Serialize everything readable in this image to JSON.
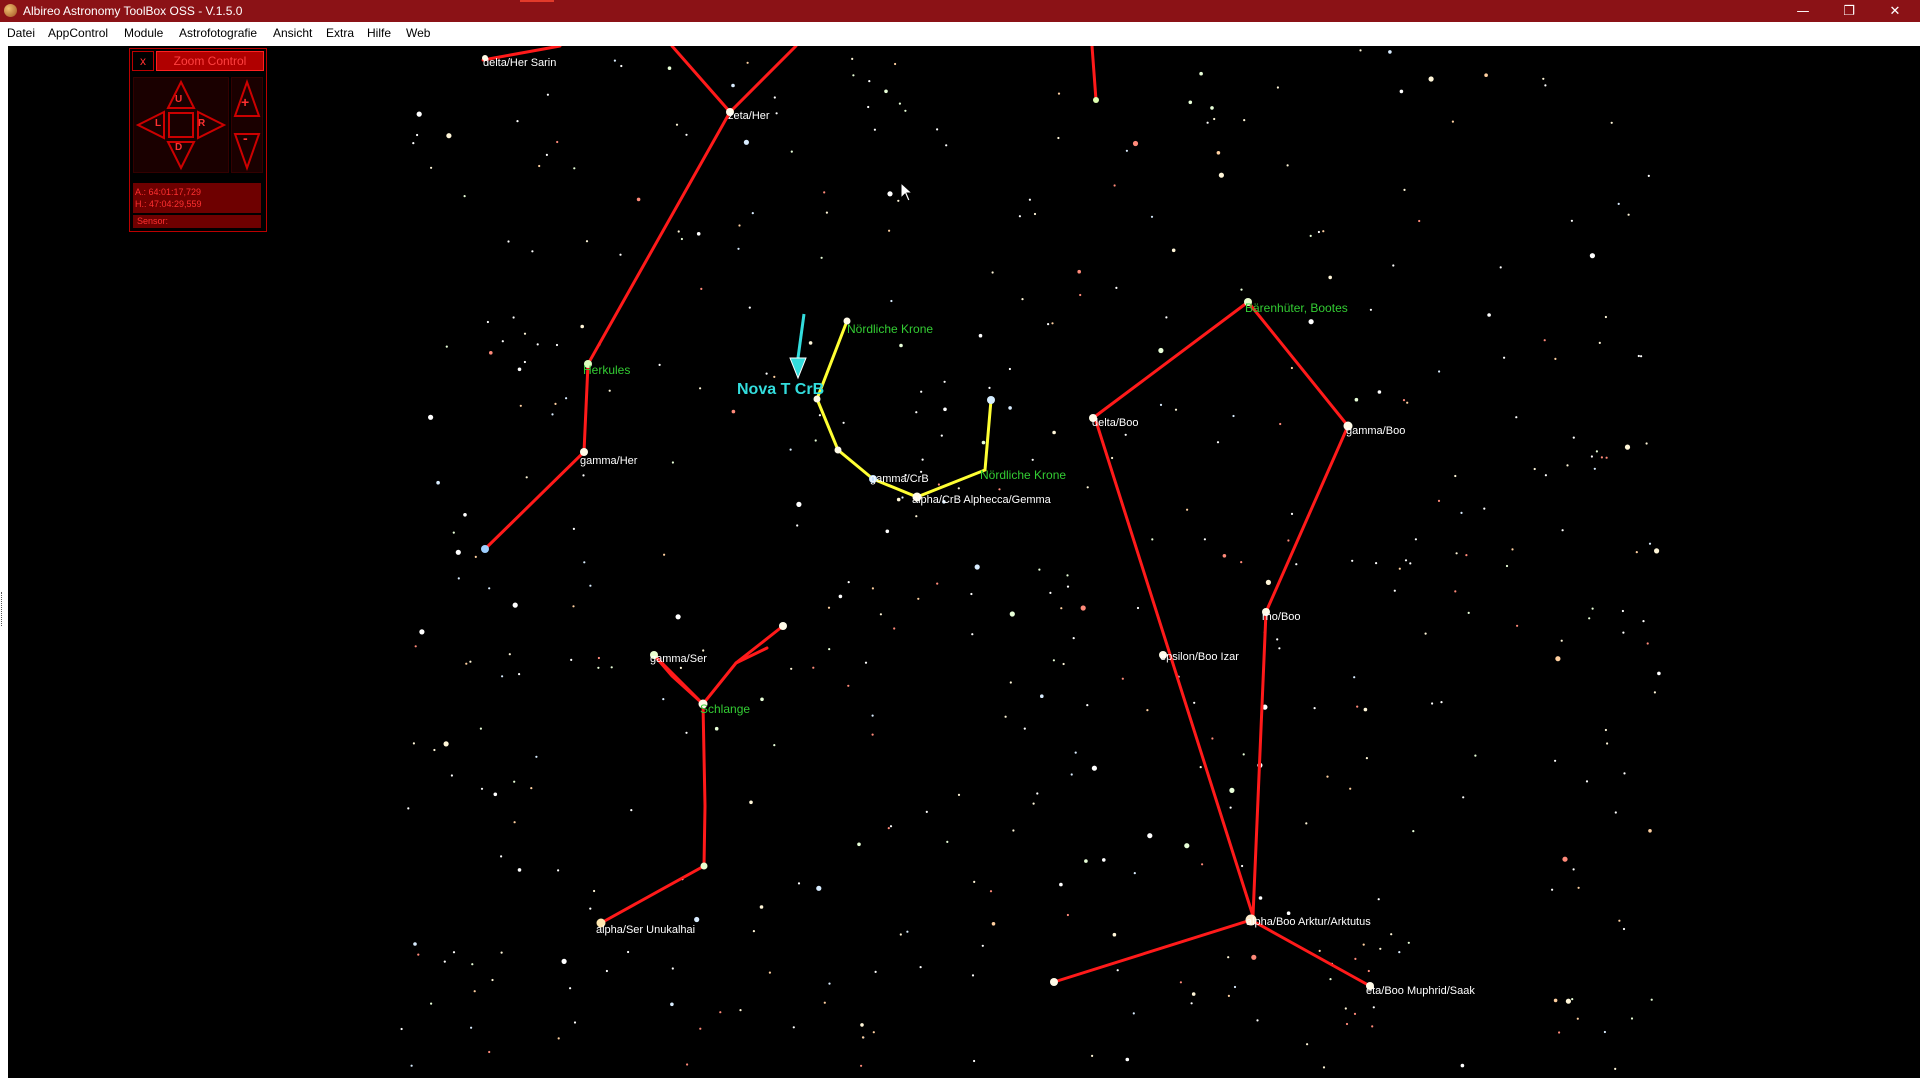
{
  "window": {
    "title": "Albireo Astronomy ToolBox OSS - V.1.5.0",
    "minimize": "—",
    "restore": "❐",
    "close": "✕"
  },
  "menu": [
    "Datei",
    "AppControl",
    "Module",
    "Astrofotografie",
    "Ansicht",
    "Extra",
    "Hilfe",
    "Web"
  ],
  "zoom_control": {
    "close_label": "x",
    "title": "Zoom Control",
    "up": "U",
    "down": "D",
    "left": "L",
    "right": "R",
    "zoom_in": "+",
    "zoom_out": "-",
    "azimuth": "A.: 64:01:17,729",
    "height": "H.: 47:04:29,559",
    "sensor": "Sensor:"
  },
  "colors": {
    "sky": "#000000",
    "constellation_line": "#ff1a1a",
    "highlight_line": "#ffff33",
    "constellation_label": "#33cc33",
    "star_label": "#ffffff",
    "marker": "#33dddd",
    "titlebar": "#8b1216"
  },
  "marker": {
    "label": "Nova T CrB",
    "icon": "arrow-down-icon"
  },
  "constellation_labels": [
    "Nördliche Krone",
    "Nördliche Krone",
    "Herkules",
    "Bärenhüter, Bootes",
    "Schlange"
  ],
  "star_labels": [
    "delta/Her Sarin",
    "zeta/Her",
    "gamma/Her",
    "gamma/CrB",
    "alpha/CrB Alphecca/Gemma",
    "delta/Boo",
    "gamma/Boo",
    "rho/Boo",
    "epsilon/Boo Izar",
    "alpha/Boo Arktur/Arktutus",
    "eta/Boo Muphrid/Saak",
    "gamma/Ser",
    "alpha/Ser Unukalhai"
  ]
}
